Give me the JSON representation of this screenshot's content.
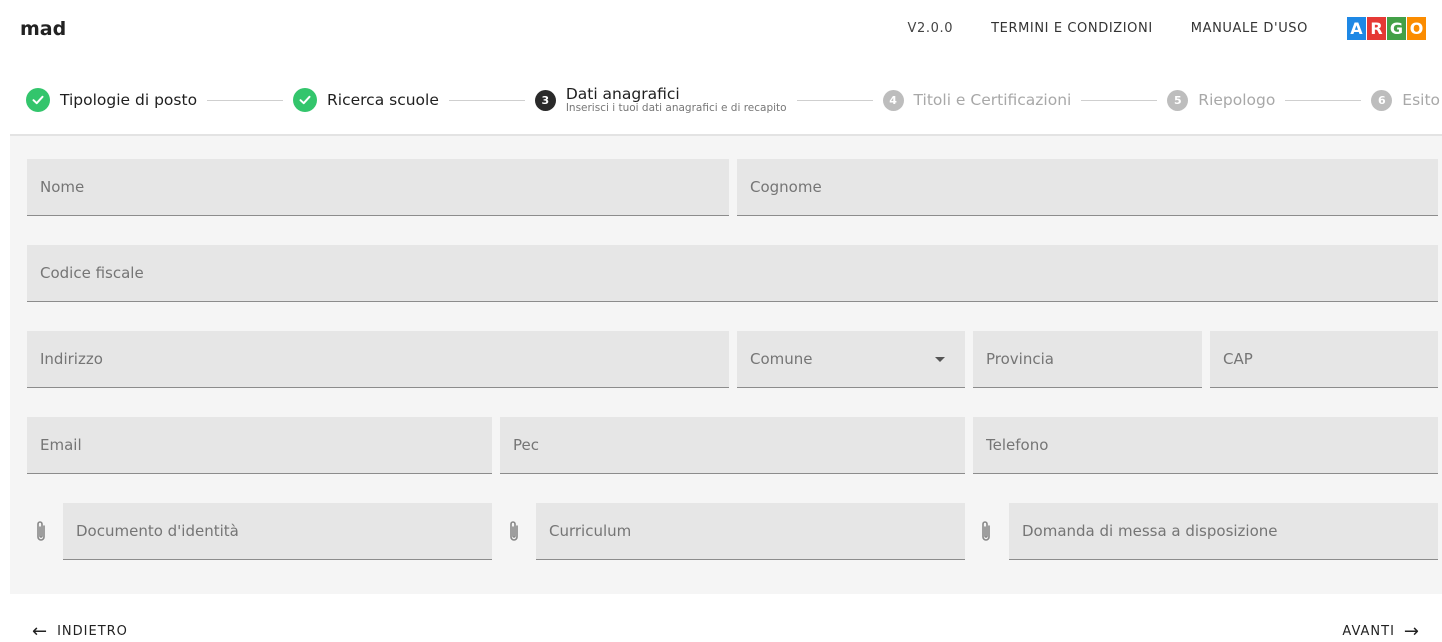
{
  "header": {
    "app_name": "mad",
    "version": "V2.0.0",
    "terms_link": "TERMINI E CONDIZIONI",
    "manual_link": "MANUALE D'USO",
    "logo": {
      "letters": [
        "A",
        "R",
        "G",
        "O"
      ],
      "colors": [
        "#1e88e5",
        "#e53935",
        "#43a047",
        "#fb8c00"
      ]
    }
  },
  "stepper": {
    "steps": [
      {
        "label": "Tipologie di posto",
        "status": "done",
        "icon": "check-icon"
      },
      {
        "label": "Ricerca scuole",
        "status": "done",
        "icon": "check-icon"
      },
      {
        "number": "3",
        "label": "Dati anagrafici",
        "sublabel": "Inserisci i tuoi dati anagrafici e di recapito",
        "status": "active"
      },
      {
        "number": "4",
        "label": "Titoli e Certificazioni",
        "status": "inactive"
      },
      {
        "number": "5",
        "label": "Riepologo",
        "status": "inactive"
      },
      {
        "number": "6",
        "label": "Esito",
        "status": "inactive"
      }
    ],
    "colors": {
      "done": "#33c56c",
      "active": "#2a2a2a",
      "inactive": "#bdbdbd"
    }
  },
  "form": {
    "nome": {
      "placeholder": "Nome",
      "value": ""
    },
    "cognome": {
      "placeholder": "Cognome",
      "value": ""
    },
    "codice_fiscale": {
      "placeholder": "Codice fiscale",
      "value": ""
    },
    "indirizzo": {
      "placeholder": "Indirizzo",
      "value": ""
    },
    "comune": {
      "placeholder": "Comune",
      "value": "",
      "icon": "dropdown-caret-icon"
    },
    "provincia": {
      "placeholder": "Provincia",
      "value": ""
    },
    "cap": {
      "placeholder": "CAP",
      "value": ""
    },
    "email": {
      "placeholder": "Email",
      "value": ""
    },
    "pec": {
      "placeholder": "Pec",
      "value": ""
    },
    "telefono": {
      "placeholder": "Telefono",
      "value": ""
    },
    "documento": {
      "placeholder": "Documento d'identità",
      "value": "",
      "icon": "paperclip-icon"
    },
    "curriculum": {
      "placeholder": "Curriculum",
      "value": "",
      "icon": "paperclip-icon"
    },
    "domanda": {
      "placeholder": "Domanda di messa a disposizione",
      "value": "",
      "icon": "paperclip-icon"
    }
  },
  "footer": {
    "back_label": "INDIETRO",
    "next_label": "AVANTI",
    "back_icon": "arrow-left-icon",
    "next_icon": "arrow-right-icon"
  }
}
